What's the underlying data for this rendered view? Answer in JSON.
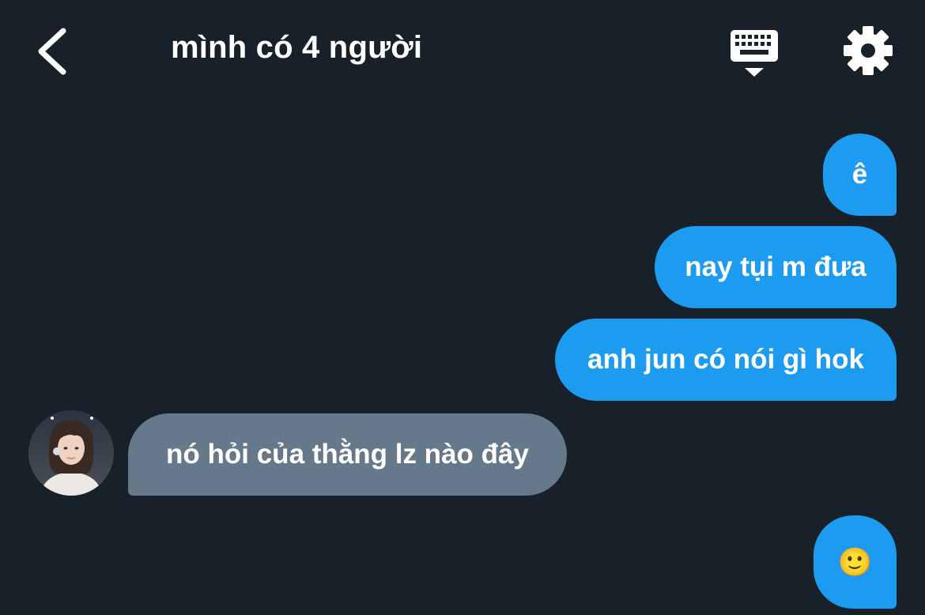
{
  "header": {
    "title": "mình có 4 người",
    "back_icon": "chevron-left-icon",
    "keyboard_icon": "keyboard-icon",
    "settings_icon": "gear-icon"
  },
  "messages": [
    {
      "direction": "outgoing",
      "text": "ê"
    },
    {
      "direction": "outgoing",
      "text": "nay tụi m đưa"
    },
    {
      "direction": "outgoing",
      "text": "anh jun có nói gì hok"
    },
    {
      "direction": "incoming",
      "text": "nó hỏi của thằng lz nào đây",
      "avatar_icon": "avatar"
    },
    {
      "direction": "outgoing",
      "text": "🙂"
    }
  ],
  "colors": {
    "background": "#18202a",
    "outgoing_bubble": "#1d9bf0",
    "incoming_bubble": "#66798a",
    "text": "#ffffff"
  }
}
